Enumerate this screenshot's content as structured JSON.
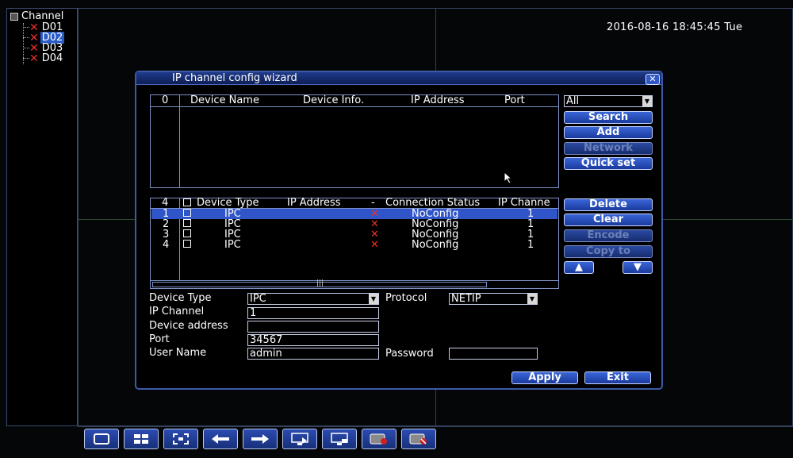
{
  "tree": {
    "root_label": "Channel",
    "items": [
      {
        "label": "D01",
        "selected": false
      },
      {
        "label": "D02",
        "selected": true
      },
      {
        "label": "D03",
        "selected": false
      },
      {
        "label": "D04",
        "selected": false
      }
    ]
  },
  "clock": "2016-08-16 18:45:45 Tue",
  "dialog": {
    "title": "IP channel config wizard",
    "close_icon": "close-icon",
    "search_panel": {
      "count": "0",
      "columns": [
        "Device Name",
        "Device Info.",
        "IP Address",
        "Port"
      ]
    },
    "filter": {
      "value": "All"
    },
    "buttons_top": [
      "Search",
      "Add",
      "Network",
      "Quick set"
    ],
    "added_panel": {
      "count": "4",
      "columns": [
        "Device Type",
        "IP Address",
        "-",
        "Connection Status",
        "IP Channe"
      ],
      "rows": [
        {
          "no": "1",
          "type": "IPC",
          "ip": "",
          "status": "NoConfig",
          "channel": "1",
          "selected": true
        },
        {
          "no": "2",
          "type": "IPC",
          "ip": "",
          "status": "NoConfig",
          "channel": "1",
          "selected": false
        },
        {
          "no": "3",
          "type": "IPC",
          "ip": "",
          "status": "NoConfig",
          "channel": "1",
          "selected": false
        },
        {
          "no": "4",
          "type": "IPC",
          "ip": "",
          "status": "NoConfig",
          "channel": "1",
          "selected": false
        }
      ]
    },
    "buttons_mid": [
      "Delete",
      "Clear",
      "Encode",
      "Copy to"
    ],
    "form": {
      "device_type_label": "Device Type",
      "device_type_value": "IPC",
      "protocol_label": "Protocol",
      "protocol_value": "NETIP",
      "ip_channel_label": "IP Channel",
      "ip_channel_value": "1",
      "device_address_label": "Device address",
      "device_address_value": "",
      "port_label": "Port",
      "port_value": "34567",
      "user_name_label": "User Name",
      "user_name_value": "admin",
      "password_label": "Password",
      "password_value": ""
    },
    "apply_label": "Apply",
    "exit_label": "Exit"
  },
  "toolbar": {
    "icons": [
      "single-view-icon",
      "quad-view-icon",
      "fullscreen-icon",
      "previous-icon",
      "next-icon",
      "playback-icon",
      "monitor-icon",
      "record-icon",
      "record-stop-icon"
    ]
  },
  "colors": {
    "accent": "#2f55c8",
    "error": "#e8302a",
    "border": "#3c5aa8"
  }
}
